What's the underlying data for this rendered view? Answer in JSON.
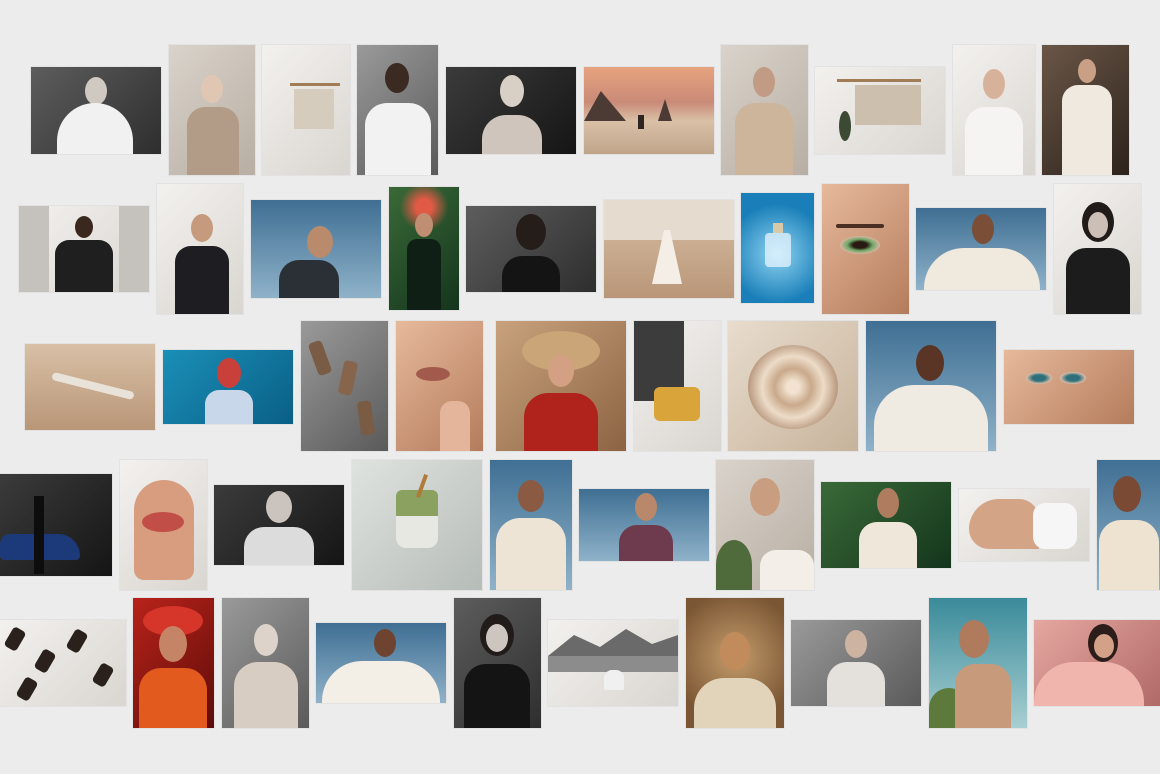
{
  "screen": {
    "background_color": "#ececec",
    "description_visible_text": ""
  },
  "tiles": [
    {
      "id": "r1-1",
      "icon": "portrait-white-cape-bw"
    },
    {
      "id": "r1-2",
      "icon": "three-models-interior"
    },
    {
      "id": "r1-3",
      "icon": "clothing-rack-light"
    },
    {
      "id": "r1-4",
      "icon": "portrait-white-shirt-bw"
    },
    {
      "id": "r1-5",
      "icon": "bald-figure-dark"
    },
    {
      "id": "r1-6",
      "icon": "beach-yoga-sunset"
    },
    {
      "id": "r1-7",
      "icon": "bald-figure-beige-coat"
    },
    {
      "id": "r1-8",
      "icon": "clothing-rack-plant"
    },
    {
      "id": "r1-9",
      "icon": "portrait-drape-white"
    },
    {
      "id": "r1-10",
      "icon": "two-models-white-suits"
    },
    {
      "id": "r2-1",
      "icon": "man-suit-architecture"
    },
    {
      "id": "r2-2",
      "icon": "woman-blazer-white-wall"
    },
    {
      "id": "r2-3",
      "icon": "profile-blue-sky"
    },
    {
      "id": "r2-4",
      "icon": "woman-flowers-green"
    },
    {
      "id": "r2-5",
      "icon": "portrait-bob-dark"
    },
    {
      "id": "r2-6",
      "icon": "dancer-desert"
    },
    {
      "id": "r2-7",
      "icon": "perfume-water"
    },
    {
      "id": "r2-8",
      "icon": "eye-closeup-makeup"
    },
    {
      "id": "r2-9",
      "icon": "woman-draped-sky"
    },
    {
      "id": "r2-10",
      "icon": "portrait-bw-blouse"
    },
    {
      "id": "r3-1",
      "icon": "driftwood-sand"
    },
    {
      "id": "r3-2",
      "icon": "woman-red-hair-blue"
    },
    {
      "id": "r3-3",
      "icon": "bottles-on-stones"
    },
    {
      "id": "r3-4",
      "icon": "lips-hand-closeup"
    },
    {
      "id": "r3-5",
      "icon": "woman-sunhat-red"
    },
    {
      "id": "r3-6",
      "icon": "yellow-chair-room"
    },
    {
      "id": "r3-7",
      "icon": "cream-swirl"
    },
    {
      "id": "r3-8",
      "icon": "woman-braids-white"
    },
    {
      "id": "r3-9",
      "icon": "face-closeup-glow"
    },
    {
      "id": "r4-1",
      "icon": "woman-blue-car"
    },
    {
      "id": "r4-2",
      "icon": "lips-white-hood"
    },
    {
      "id": "r4-3",
      "icon": "portrait-blazer-bw"
    },
    {
      "id": "r4-4",
      "icon": "matcha-drink"
    },
    {
      "id": "r4-5",
      "icon": "woman-braids-cream"
    },
    {
      "id": "r4-6",
      "icon": "woman-looking-up-sky"
    },
    {
      "id": "r4-7",
      "icon": "woman-palms"
    },
    {
      "id": "r4-8",
      "icon": "woman-green-leaves"
    },
    {
      "id": "r4-9",
      "icon": "shoulder-white-top"
    },
    {
      "id": "r4-10",
      "icon": "woman-braids-beige"
    },
    {
      "id": "r5-1",
      "icon": "dark-bottles-pattern"
    },
    {
      "id": "r5-2",
      "icon": "woman-red-floral"
    },
    {
      "id": "r5-3",
      "icon": "bald-figure-studio"
    },
    {
      "id": "r5-4",
      "icon": "woman-white-drape-sky"
    },
    {
      "id": "r5-5",
      "icon": "portrait-black-top-bw"
    },
    {
      "id": "r5-6",
      "icon": "meditation-mountains-bw"
    },
    {
      "id": "r5-7",
      "icon": "woman-fur-hood"
    },
    {
      "id": "r5-8",
      "icon": "bald-figure-light"
    },
    {
      "id": "r5-9",
      "icon": "woman-ocean"
    },
    {
      "id": "r5-10",
      "icon": "woman-pink-fur"
    }
  ]
}
